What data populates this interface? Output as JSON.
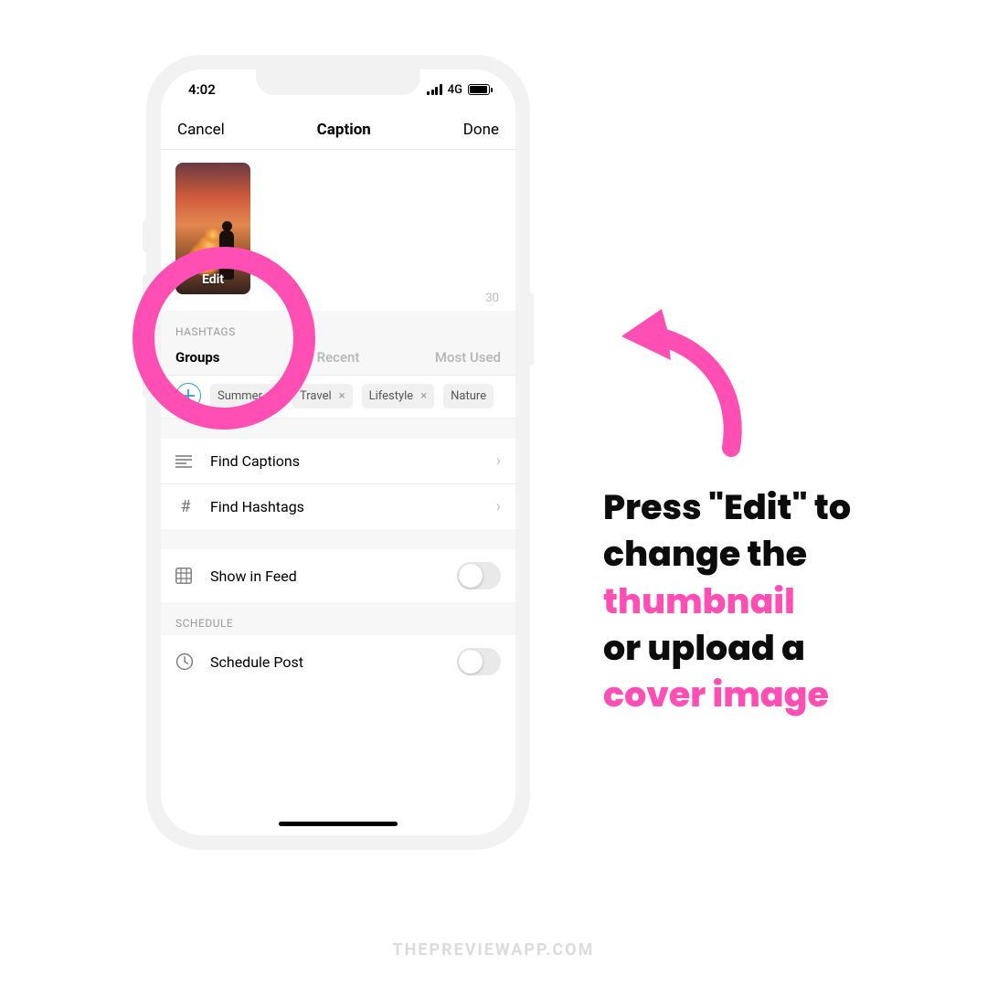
{
  "colors": {
    "pink": "#ff4fb5",
    "accent_blue": "#2e9fd7"
  },
  "statusbar": {
    "time": "4:02",
    "network": "4G"
  },
  "navbar": {
    "cancel": "Cancel",
    "title": "Caption",
    "done": "Done"
  },
  "thumbnail": {
    "edit_label": "Edit"
  },
  "caption": {
    "remaining": "30"
  },
  "hashtags": {
    "section_label": "HASHTAGS",
    "tabs": {
      "groups": "Groups",
      "recent": "Recent",
      "most_used": "Most Used"
    },
    "chips": [
      "Summer",
      "Travel",
      "Lifestyle",
      "Nature"
    ]
  },
  "rows": {
    "find_captions": "Find Captions",
    "find_hashtags": "Find Hashtags",
    "show_in_feed": "Show in Feed",
    "schedule_section": "SCHEDULE",
    "schedule_post": "Schedule Post"
  },
  "callout": {
    "l1": "Press \"Edit\" to",
    "l2": "change the",
    "l3": "thumbnail",
    "l4": "or upload a",
    "l5": "cover image"
  },
  "footer": "THEPREVIEWAPP.COM"
}
